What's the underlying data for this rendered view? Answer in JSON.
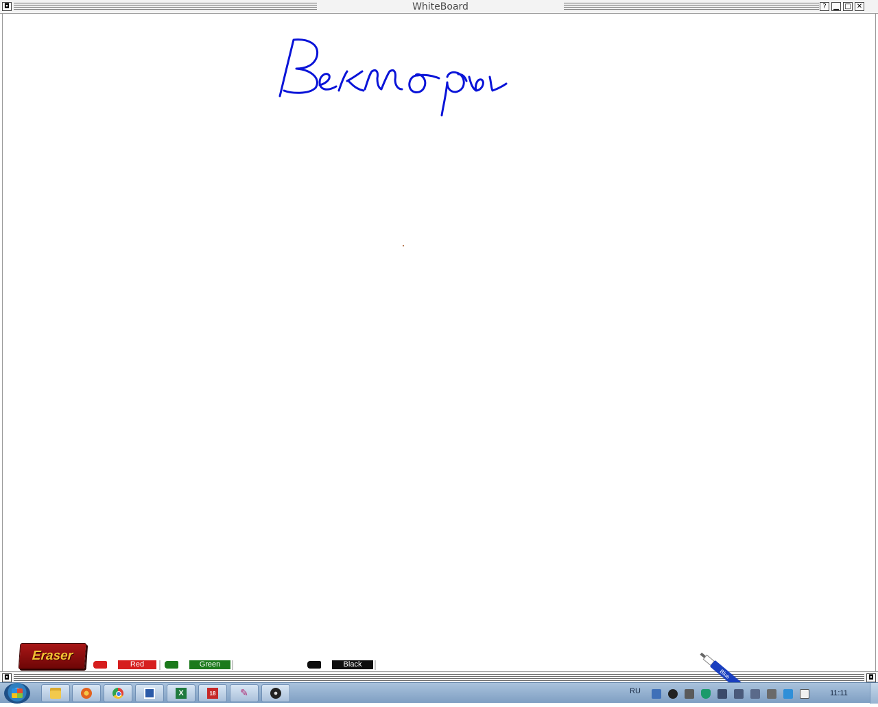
{
  "window": {
    "title": "WhiteBoard",
    "buttons": {
      "help": "?",
      "minimize": "▁",
      "maximize": "□",
      "close": "✕",
      "menu": "◘"
    }
  },
  "board": {
    "handwriting": "Векторы",
    "ink_color": "#0a14d8"
  },
  "tray_tools": {
    "eraser_label": "Eraser",
    "markers": [
      {
        "label": "Red",
        "color": "#d61e1e"
      },
      {
        "label": "Green",
        "color": "#1c7a1c"
      },
      {
        "label": "Black",
        "color": "#0e0e0e"
      }
    ],
    "active_marker": {
      "label": "Blue",
      "color": "#1a3fbf"
    }
  },
  "taskbar": {
    "apps": [
      {
        "name": "explorer",
        "icon": "folder-icon"
      },
      {
        "name": "firefox",
        "icon": "firefox-icon"
      },
      {
        "name": "chrome",
        "icon": "chrome-icon"
      },
      {
        "name": "app",
        "icon": "app-icon"
      },
      {
        "name": "excel",
        "icon": "excel-icon",
        "glyph": "X"
      },
      {
        "name": "calendar",
        "icon": "calendar-icon",
        "glyph": "18"
      },
      {
        "name": "pen-tool",
        "icon": "pen-icon",
        "glyph": "✎"
      },
      {
        "name": "media",
        "icon": "disc-icon"
      }
    ],
    "language": "RU",
    "clock": "11:11"
  }
}
